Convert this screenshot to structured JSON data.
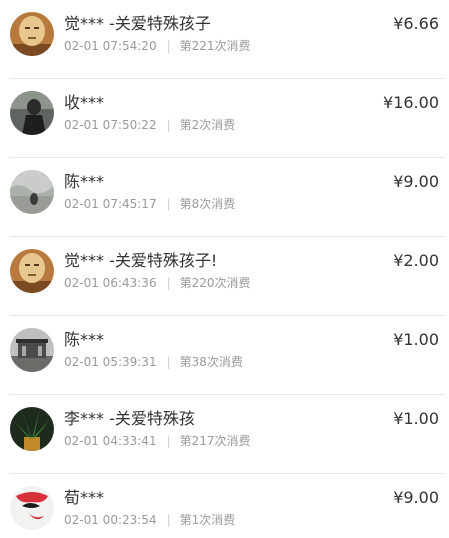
{
  "records": [
    {
      "avatar": "buddha-face-avatar",
      "name": "觉***",
      "note": " -关爱特殊孩子",
      "time": "02-01 07:54:20",
      "sep": "|",
      "count": "第221次消费",
      "amount": "¥6.66"
    },
    {
      "avatar": "dark-person-avatar",
      "name": "收***",
      "note": "",
      "time": "02-01 07:50:22",
      "sep": "|",
      "count": "第2次消费",
      "amount": "¥16.00"
    },
    {
      "avatar": "misty-landscape-avatar",
      "name": "陈***",
      "note": "",
      "time": "02-01 07:45:17",
      "sep": "|",
      "count": "第8次消费",
      "amount": "¥9.00"
    },
    {
      "avatar": "buddha-face-avatar",
      "name": "觉***",
      "note": " -关爱特殊孩子!",
      "time": "02-01 06:43:36",
      "sep": "|",
      "count": "第220次消费",
      "amount": "¥2.00"
    },
    {
      "avatar": "gray-pavilion-avatar",
      "name": "陈***",
      "note": "",
      "time": "02-01 05:39:31",
      "sep": "|",
      "count": "第38次消费",
      "amount": "¥1.00"
    },
    {
      "avatar": "green-plant-avatar",
      "name": "李***",
      "note": " -关爱特殊孩",
      "time": "02-01 04:33:41",
      "sep": "|",
      "count": "第217次消费",
      "amount": "¥1.00"
    },
    {
      "avatar": "opera-mask-avatar",
      "name": "荀***",
      "note": "",
      "time": "02-01 00:23:54",
      "sep": "|",
      "count": "第1次消费",
      "amount": "¥9.00"
    }
  ]
}
